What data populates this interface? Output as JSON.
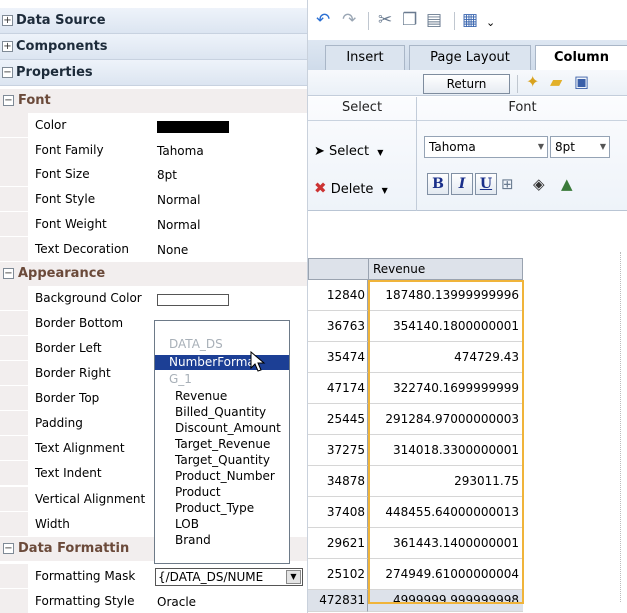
{
  "left_panel": {
    "sections": {
      "data_source": "Data Source",
      "components": "Components",
      "properties": "Properties"
    },
    "toggles": {
      "collapsed": "+",
      "expanded": "−"
    },
    "groups": {
      "font": "Font",
      "appearance": "Appearance",
      "data_formatting": "Data Formattin"
    },
    "font_props": [
      {
        "name": "Color",
        "value": ""
      },
      {
        "name": "Font Family",
        "value": "Tahoma"
      },
      {
        "name": "Font Size",
        "value": "8pt"
      },
      {
        "name": "Font Style",
        "value": "Normal"
      },
      {
        "name": "Font Weight",
        "value": "Normal"
      },
      {
        "name": "Text Decoration",
        "value": "None"
      }
    ],
    "appearance_props": [
      "Background Color",
      "Border Bottom",
      "Border Left",
      "Border Right",
      "Border Top",
      "Padding",
      "Text Alignment",
      "Text Indent",
      "Vertical Alignment",
      "Width"
    ],
    "formatting_props": [
      {
        "name": "Formatting Mask",
        "value": "{/DATA_DS/NUME"
      },
      {
        "name": "Formatting Style",
        "value": "Oracle"
      }
    ],
    "dropdown_list": {
      "items": [
        {
          "label": "DATA_DS",
          "kind": "gray"
        },
        {
          "label": "NumberFormat",
          "kind": "selected"
        },
        {
          "label": "G_1",
          "kind": "gray"
        },
        {
          "label": "Revenue",
          "kind": "sub"
        },
        {
          "label": "Billed_Quantity",
          "kind": "sub"
        },
        {
          "label": "Discount_Amount",
          "kind": "sub"
        },
        {
          "label": "Target_Revenue",
          "kind": "sub"
        },
        {
          "label": "Target_Quantity",
          "kind": "sub"
        },
        {
          "label": "Product_Number",
          "kind": "sub"
        },
        {
          "label": "Product",
          "kind": "sub"
        },
        {
          "label": "Product_Type",
          "kind": "sub"
        },
        {
          "label": "LOB",
          "kind": "sub"
        },
        {
          "label": "Brand",
          "kind": "sub"
        }
      ]
    },
    "colors": {
      "font_color": "#000000",
      "background_color": "#ffffff",
      "selection": "#1c3f95"
    }
  },
  "right_panel": {
    "toolbar_icons": [
      "undo-icon",
      "redo-icon",
      "cut-icon",
      "copy-icon",
      "paste-icon",
      "table-icon",
      "more-icon"
    ],
    "tabs": [
      {
        "label": "Insert",
        "active": false
      },
      {
        "label": "Page Layout",
        "active": false
      },
      {
        "label": "Column",
        "active": true
      }
    ],
    "return_button": "Return",
    "ribbon": {
      "select_group": "Select",
      "font_group": "Font",
      "select_button": "Select",
      "delete_button": "Delete",
      "font_family": "Tahoma",
      "font_size": "8pt",
      "bold": "B",
      "italic": "I",
      "underline": "U"
    },
    "table": {
      "header": "Revenue",
      "rows": [
        [
          "12840",
          "187480.13999999996"
        ],
        [
          "36763",
          "354140.1800000001"
        ],
        [
          "35474",
          "474729.43"
        ],
        [
          "47174",
          "322740.1699999999"
        ],
        [
          "25445",
          "291284.97000000003"
        ],
        [
          "37275",
          "314018.3300000001"
        ],
        [
          "34878",
          "293011.75"
        ],
        [
          "37408",
          "448455.64000000013"
        ],
        [
          "29621",
          "361443.1400000001"
        ],
        [
          "25102",
          "274949.61000000004"
        ],
        [
          "472831",
          "4999999.999999998"
        ]
      ]
    }
  }
}
